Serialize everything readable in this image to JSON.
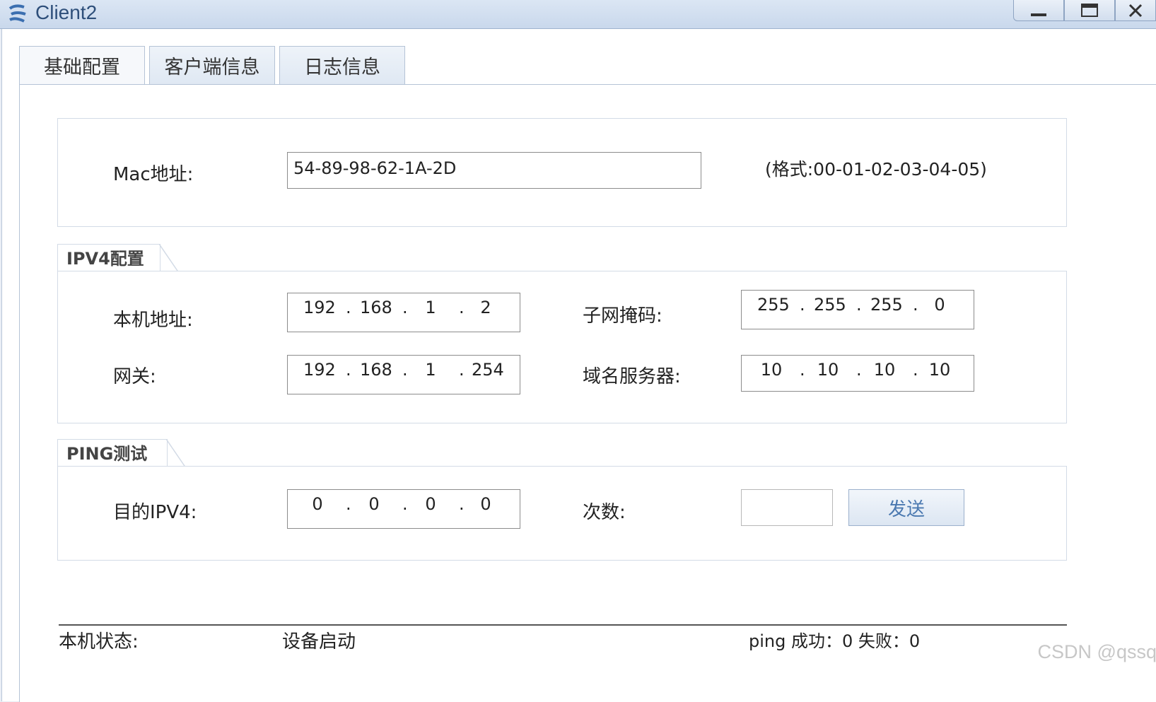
{
  "window": {
    "title": "Client2",
    "minimize_label": "_",
    "maximize_label": "□",
    "close_label": "X"
  },
  "tabs": [
    {
      "label": "基础配置"
    },
    {
      "label": "客户端信息"
    },
    {
      "label": "日志信息"
    }
  ],
  "mac": {
    "label": "Mac地址:",
    "value": "54-89-98-62-1A-2D",
    "hint": "(格式:00-01-02-03-04-05)"
  },
  "ipv4": {
    "section_title": "IPV4配置",
    "local_label": "本机地址:",
    "local_octets": [
      "192",
      "168",
      "1",
      "2"
    ],
    "mask_label": "子网掩码:",
    "mask_octets": [
      "255",
      "255",
      "255",
      "0"
    ],
    "gateway_label": "网关:",
    "gateway_octets": [
      "192",
      "168",
      "1",
      "254"
    ],
    "dns_label": "域名服务器:",
    "dns_octets": [
      "10",
      "10",
      "10",
      "10"
    ]
  },
  "ping": {
    "section_title": "PING测试",
    "dest_label": "目的IPV4:",
    "dest_octets": [
      "0",
      "0",
      "0",
      "0"
    ],
    "count_label": "次数:",
    "count_value": "",
    "send_label": "发送"
  },
  "status": {
    "label": "本机状态:",
    "value": "设备启动",
    "ping_result": "ping 成功：0 失败：0"
  },
  "watermark": "CSDN @qssq"
}
